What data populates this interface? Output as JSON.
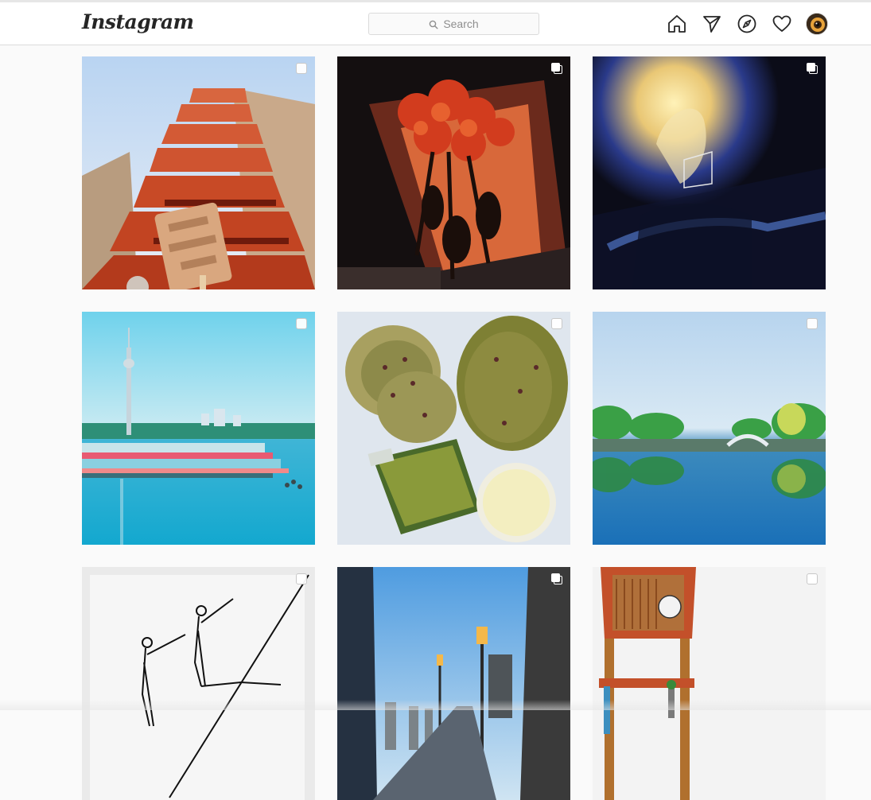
{
  "app": {
    "logo_text": "Instagram",
    "search_placeholder": "Search"
  },
  "nav": {
    "icons": [
      "home-icon",
      "direct-message-icon",
      "explore-compass-icon",
      "activity-heart-icon",
      "profile-avatar"
    ]
  },
  "colors": {
    "header_bg": "#ffffff",
    "page_bg": "#fafafa",
    "border": "#dbdbdb",
    "text_dark": "#262626",
    "text_muted": "#8e8e8e"
  },
  "posts": [
    {
      "subject": "red temple pagoda with ice cream bar",
      "multi": false
    },
    {
      "subject": "red flowers bouquet",
      "multi": true
    },
    {
      "subject": "glowing figure blue dark",
      "multi": true
    },
    {
      "subject": "tv tower and lake with boats",
      "multi": false
    },
    {
      "subject": "matcha bread with jar and milk",
      "multi": false
    },
    {
      "subject": "lake with bridge and trees reflection",
      "multi": false
    },
    {
      "subject": "line drawing of pointing figures",
      "multi": false
    },
    {
      "subject": "waterfront promenade with lamps",
      "multi": true
    },
    {
      "subject": "wooden gate with round sign",
      "multi": false
    }
  ]
}
